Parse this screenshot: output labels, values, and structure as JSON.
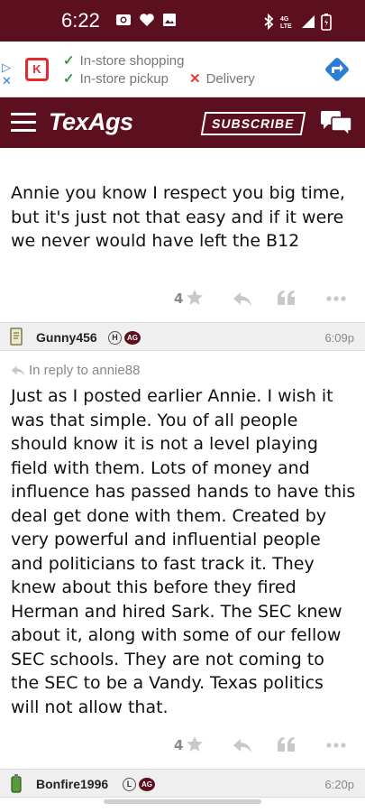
{
  "status_bar": {
    "time": "6:22",
    "network": "4G LTE",
    "icons": [
      "camera-icon",
      "heart-icon",
      "image-icon",
      "bluetooth-icon",
      "signal-icon",
      "battery-icon"
    ]
  },
  "ad": {
    "line1": "In-store shopping",
    "line2": "In-store pickup",
    "line3": "Delivery",
    "brand_letter": "K",
    "colors": {
      "check": "#2e9a4a",
      "x": "#e43b3b",
      "directions": "#2a7fd4"
    }
  },
  "nav": {
    "brand": "TexAgs",
    "subscribe_label": "SUBSCRIBE",
    "bg": "#5b0f1f"
  },
  "posts": [
    {
      "text": "Annie you know I respect you big time, but it's just not that easy and if it were we never would have left the B12",
      "likes": "4"
    },
    {
      "author": "Gunny456",
      "badge_letter": "H",
      "badge_tag": "AG",
      "time": "6:09p",
      "in_reply_to": "In reply to annie88",
      "text": "Just as I posted earlier Annie. I wish it was that simple. You of all people should know it is not a level playing field with them. Lots of money and influence has passed hands to have this deal get done with them. Created by very powerful and influential people and politicians to fast track it. They knew about this before they fired Herman and hired Sark. The SEC knew about it, along with some of our fellow SEC schools. They are not coming to the SEC to be a Vandy. Texas politics will not allow that.",
      "likes": "4"
    },
    {
      "author": "Bonfire1996",
      "badge_letter": "L",
      "badge_tag": "AG",
      "time": "6:20p"
    }
  ]
}
